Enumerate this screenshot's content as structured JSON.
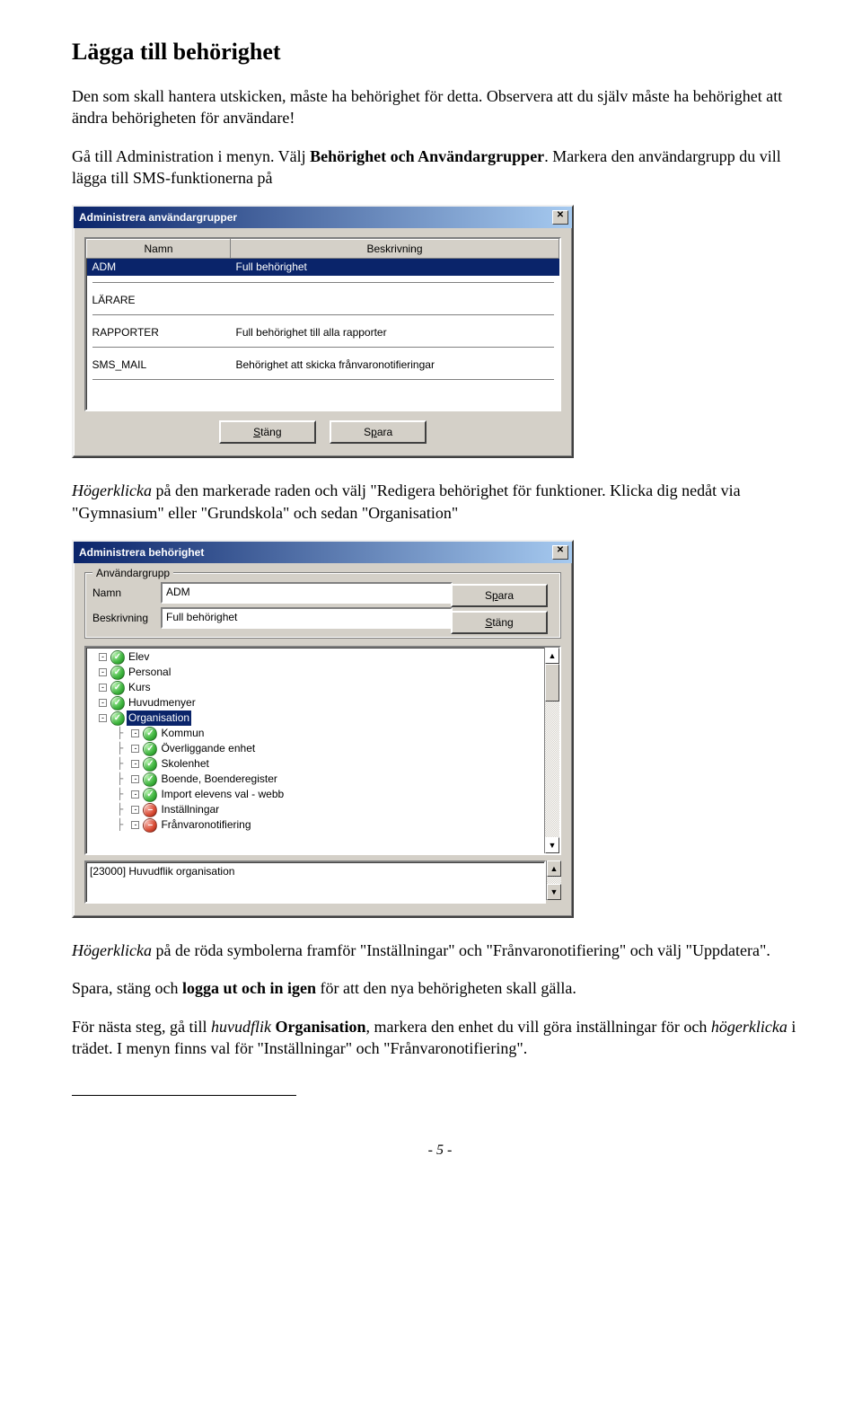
{
  "heading": "Lägga till behörighet",
  "para1": "Den som skall hantera utskicken, måste ha behörighet för detta. Observera att du själv måste ha behörighet att ändra behörigheten för användare!",
  "para2_a": "Gå till Administration i menyn. Välj ",
  "para2_b": "Behörighet och Användargrupper",
  "para2_c": ". Markera den användargrupp du vill lägga till SMS-funktionerna på",
  "para3_a": "Högerklicka",
  "para3_b": " på den markerade raden och välj \"Redigera behörighet för funktioner. Klicka dig nedåt via \"Gymnasium\" eller \"Grundskola\" och sedan \"Organisation\"",
  "para4_a": "Högerklicka",
  "para4_b": " på de röda symbolerna framför \"Inställningar\" och \"Frånvaronotifiering\" och välj \"Uppdatera\".",
  "para5_a": "Spara, stäng och ",
  "para5_b": "logga ut och in igen",
  "para5_c": " för att den nya behörigheten skall gälla.",
  "para6_a": "För nästa steg, gå till ",
  "para6_b": "huvudflik",
  "para6_c": "  ",
  "para6_d": "Organisation",
  "para6_e": ", markera den enhet du vill göra inställningar för och ",
  "para6_f": "högerklicka",
  "para6_g": " i trädet. I menyn finns val för \"Inställningar\" och \"Frånvaronotifiering\".",
  "footer": "- 5 -",
  "dlg1": {
    "title": "Administrera användargrupper",
    "close": "✕",
    "col_name": "Namn",
    "col_desc": "Beskrivning",
    "rows": [
      {
        "name": "ADM",
        "desc": "Full behörighet",
        "selected": true
      },
      {
        "name": "LÄRARE",
        "desc": ""
      },
      {
        "name": "RAPPORTER",
        "desc": "Full behörighet till alla rapporter"
      },
      {
        "name": "SMS_MAIL",
        "desc": "Behörighet att skicka frånvaronotifieringar"
      }
    ],
    "btn_close": "Stäng",
    "btn_save": "Spara",
    "underline_close": "S",
    "underline_save": "p"
  },
  "dlg2": {
    "title": "Administrera behörighet",
    "close": "✕",
    "legend": "Användargrupp",
    "lbl_name": "Namn",
    "lbl_desc": "Beskrivning",
    "val_name": "ADM",
    "val_desc": "Full behörighet",
    "btn_save": "Spara",
    "btn_close": "Stäng",
    "underline_save": "p",
    "underline_close": "S",
    "tree": [
      {
        "indent": 0,
        "toggle": "-",
        "icon": "green",
        "label": "Elev"
      },
      {
        "indent": 0,
        "toggle": "-",
        "icon": "green",
        "label": "Personal"
      },
      {
        "indent": 0,
        "toggle": "-",
        "icon": "green",
        "label": "Kurs"
      },
      {
        "indent": 0,
        "toggle": "-",
        "icon": "green",
        "label": "Huvudmenyer"
      },
      {
        "indent": 0,
        "toggle": "-",
        "icon": "green",
        "label": "Organisation",
        "selected": true
      },
      {
        "indent": 1,
        "toggle": "-",
        "icon": "green",
        "label": "Kommun"
      },
      {
        "indent": 1,
        "toggle": "-",
        "icon": "green",
        "label": "Överliggande enhet"
      },
      {
        "indent": 1,
        "toggle": "-",
        "icon": "green",
        "label": "Skolenhet"
      },
      {
        "indent": 1,
        "toggle": "-",
        "icon": "green",
        "label": "Boende, Boenderegister"
      },
      {
        "indent": 1,
        "toggle": "-",
        "icon": "green",
        "label": "Import elevens val - webb"
      },
      {
        "indent": 1,
        "toggle": "-",
        "icon": "red",
        "label": "Inställningar"
      },
      {
        "indent": 1,
        "toggle": "-",
        "icon": "red",
        "label": "Frånvaronotifiering"
      }
    ],
    "status": "[23000] Huvudflik organisation"
  }
}
